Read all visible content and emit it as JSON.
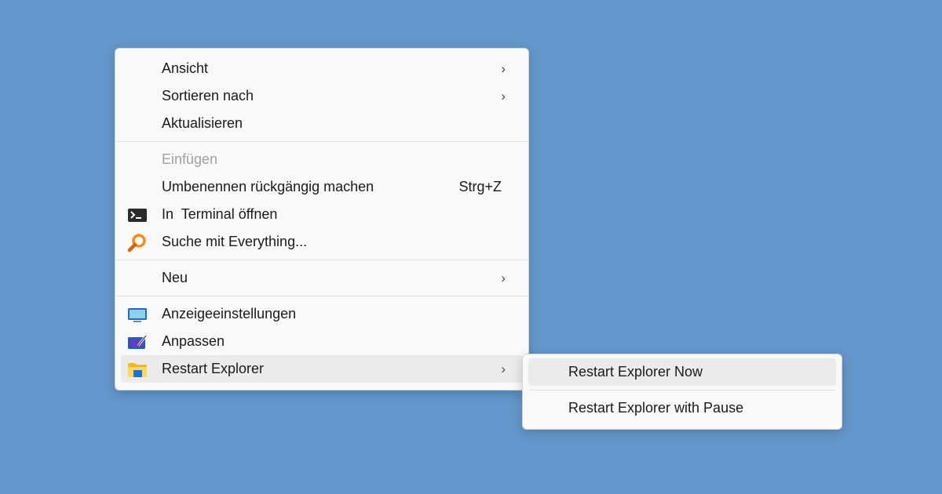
{
  "main_menu": {
    "items": [
      {
        "label": "Ansicht"
      },
      {
        "label": "Sortieren nach"
      },
      {
        "label": "Aktualisieren"
      },
      {
        "label": "Einfügen"
      },
      {
        "label": "Umbenennen rückgängig machen",
        "shortcut": "Strg+Z"
      },
      {
        "label": "In  Terminal öffnen",
        "icon": "terminal-icon"
      },
      {
        "label": "Suche mit Everything...",
        "icon": "everything-search-icon"
      },
      {
        "label": "Neu"
      },
      {
        "label": "Anzeigeeinstellungen",
        "icon": "display-settings-icon"
      },
      {
        "label": "Anpassen",
        "icon": "personalize-icon"
      },
      {
        "label": "Restart Explorer",
        "icon": "folder-icon"
      }
    ]
  },
  "sub_menu": {
    "items": [
      {
        "label": "Restart Explorer Now"
      },
      {
        "label": "Restart Explorer with Pause"
      }
    ]
  },
  "colors": {
    "desktop": "#6497cb",
    "menu_bg": "#f9f9f9",
    "highlight": "#ebebeb"
  }
}
